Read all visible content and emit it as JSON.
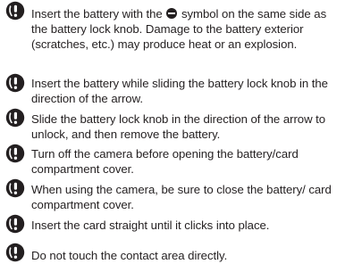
{
  "icon": "caution-icon",
  "colors": {
    "text": "#231f20",
    "icon_fill": "#231f20",
    "icon_highlight": "#ffffff"
  },
  "notes": [
    {
      "text_before_symbol": "Insert the battery with the ",
      "symbol": "minus-circle-icon",
      "text_after_symbol": " symbol on the same side as the battery lock knob. Damage to the battery exterior (scratches, etc.) may produce heat or an explosion."
    },
    {
      "text": "Insert the battery while sliding the battery lock knob in the direction of the arrow."
    },
    {
      "text": "Slide the battery lock knob in the direction of the arrow to unlock, and then remove the battery."
    },
    {
      "text": "Turn off the camera before opening the battery/card compartment cover."
    },
    {
      "text": "When using the camera, be sure to close the battery/ card compartment cover."
    },
    {
      "text": "Insert the card straight until it clicks into place."
    },
    {
      "text": "Do not touch the contact area directly."
    }
  ]
}
